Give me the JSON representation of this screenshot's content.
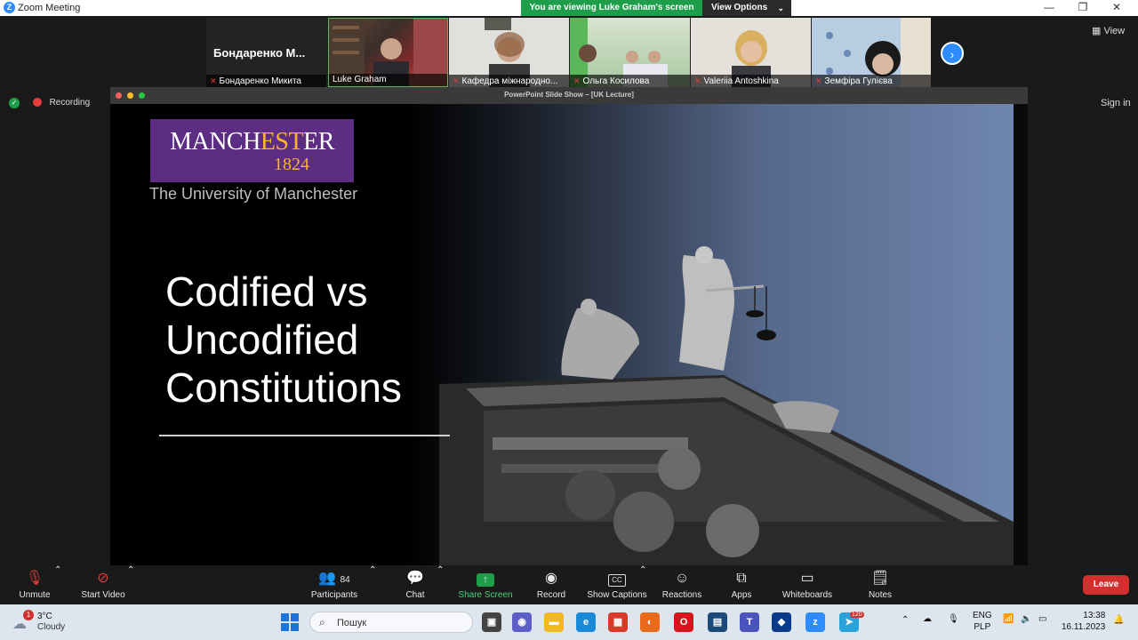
{
  "window": {
    "title": "Zoom Meeting"
  },
  "share_banner": {
    "text": "You are viewing Luke Graham's screen",
    "options_label": "View Options"
  },
  "gallery": {
    "first_tile_name": "Бондаренко  М...",
    "tiles": [
      {
        "name": "Бондаренко Микита",
        "muted": true
      },
      {
        "name": "Luke Graham",
        "muted": false
      },
      {
        "name": "Кафедра міжнародно...",
        "muted": true
      },
      {
        "name": "Ольга Косилова",
        "muted": true
      },
      {
        "name": "Valeriia Antoshkina",
        "muted": true
      },
      {
        "name": "Земфіра Гулієва",
        "muted": true
      }
    ]
  },
  "view_label": "View",
  "recording_label": "Recording",
  "sign_in_label": "Sign in",
  "shared_window_title": "PowerPoint Slide Show – [UK Lecture]",
  "slide": {
    "logo_text": {
      "part1": "MANCH",
      "part2": "EST",
      "part3": "ER",
      "year": "1824"
    },
    "university": "The University of Manchester",
    "title_lines": [
      "Codified vs",
      "Uncodified",
      "Constitutions"
    ]
  },
  "toolbar": {
    "unmute": "Unmute",
    "start_video": "Start Video",
    "participants": "Participants",
    "participants_count": "84",
    "chat": "Chat",
    "share_screen": "Share Screen",
    "record": "Record",
    "show_captions": "Show Captions",
    "reactions": "Reactions",
    "apps": "Apps",
    "whiteboards": "Whiteboards",
    "notes": "Notes",
    "leave": "Leave"
  },
  "taskbar": {
    "weather_temp": "3°C",
    "weather_desc": "Cloudy",
    "weather_badge": "1",
    "search_placeholder": "Пошук",
    "lang_line1": "ENG",
    "lang_line2": "PLP",
    "time": "13:38",
    "date": "16.11.2023",
    "telegram_badge": "120"
  },
  "colors": {
    "banner_green": "#1e9e4a",
    "zoom_blue": "#2d8cff",
    "leave_red": "#d22f2f",
    "manchester_purple": "#5c2d83",
    "manchester_gold": "#f7b332"
  }
}
